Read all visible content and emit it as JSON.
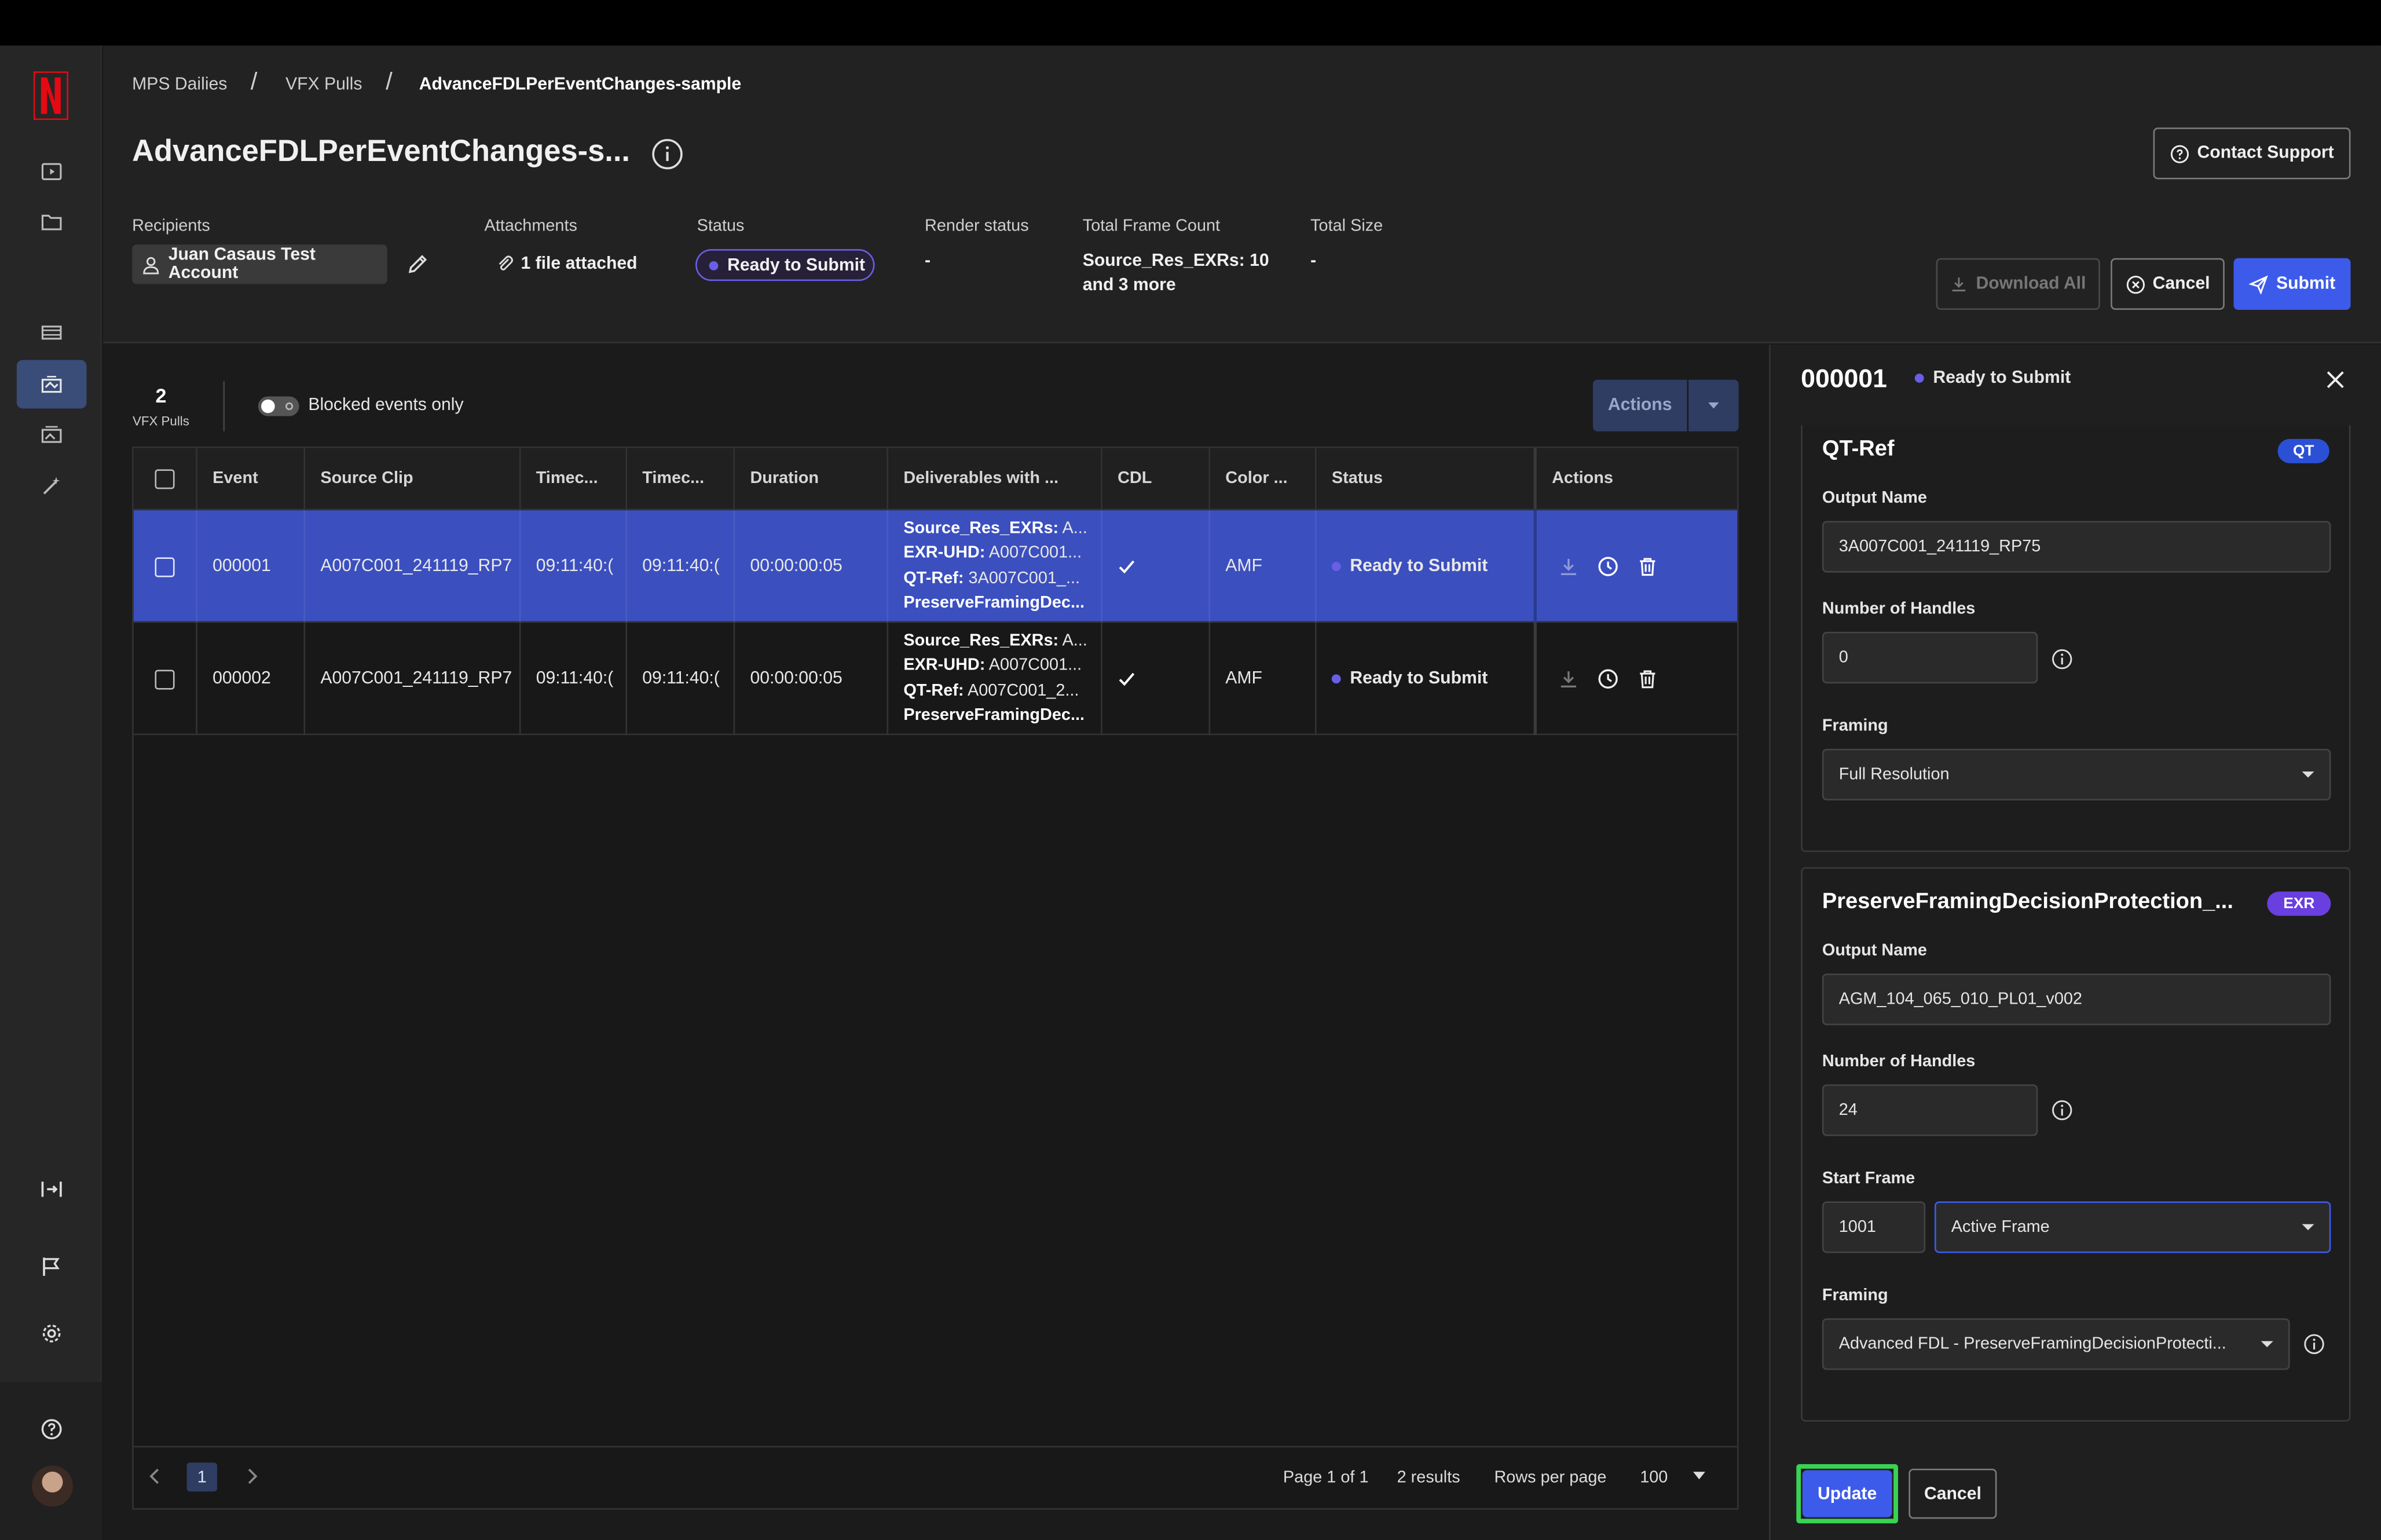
{
  "breadcrumb": [
    "MPS Dailies",
    "VFX Pulls",
    "AdvanceFDLPerEventChanges-sample"
  ],
  "title": "AdvanceFDLPerEventChanges-s...",
  "contact_support": "Contact Support",
  "meta": {
    "recipients_label": "Recipients",
    "recipient": "Juan Casaus Test Account",
    "attachments_label": "Attachments",
    "attachments_value": "1 file attached",
    "status_label": "Status",
    "status_value": "Ready to Submit",
    "render_status_label": "Render status",
    "render_status_value": "-",
    "frame_count_label": "Total Frame Count",
    "frame_count_line1": "Source_Res_EXRs: 10",
    "frame_count_line2": "and 3 more",
    "total_size_label": "Total Size",
    "total_size_value": "-"
  },
  "header_buttons": {
    "download_all": "Download All",
    "cancel": "Cancel",
    "submit": "Submit"
  },
  "toolbar": {
    "count": "2",
    "count_label": "VFX Pulls",
    "toggle_label": "Blocked events only",
    "actions": "Actions"
  },
  "table": {
    "columns": [
      "Event",
      "Source Clip",
      "Timec...",
      "Timec...",
      "Duration",
      "Deliverables with ...",
      "CDL",
      "Color ...",
      "Status",
      "Actions"
    ],
    "rows": [
      {
        "event": "000001",
        "clip": "A007C001_241119_RP7",
        "tc_in": "09:11:40:(",
        "tc_out": "09:11:40:(",
        "duration": "00:00:00:05",
        "deliv": [
          [
            "Source_Res_EXRs:",
            " A..."
          ],
          [
            "EXR-UHD:",
            " A007C001..."
          ],
          [
            "QT-Ref:",
            " 3A007C001_..."
          ],
          [
            "PreserveFramingDec...",
            ""
          ]
        ],
        "color": "AMF",
        "status": "Ready to Submit"
      },
      {
        "event": "000002",
        "clip": "A007C001_241119_RP7",
        "tc_in": "09:11:40:(",
        "tc_out": "09:11:40:(",
        "duration": "00:00:00:05",
        "deliv": [
          [
            "Source_Res_EXRs:",
            " A..."
          ],
          [
            "EXR-UHD:",
            " A007C001..."
          ],
          [
            "QT-Ref:",
            " A007C001_2..."
          ],
          [
            "PreserveFramingDec...",
            ""
          ]
        ],
        "color": "AMF",
        "status": "Ready to Submit"
      }
    ]
  },
  "pagination": {
    "page": "1",
    "page_info": "Page 1 of 1",
    "results": "2 results",
    "rows_label": "Rows per page",
    "rows_value": "100"
  },
  "panel": {
    "event_id": "000001",
    "status": "Ready to Submit",
    "card1": {
      "title": "QT-Ref",
      "badge": "QT",
      "output_label": "Output Name",
      "output_value": "3A007C001_241119_RP75",
      "handles_label": "Number of Handles",
      "handles_value": "0",
      "framing_label": "Framing",
      "framing_value": "Full Resolution"
    },
    "card2": {
      "title": "PreserveFramingDecisionProtection_...",
      "badge": "EXR",
      "output_label": "Output Name",
      "output_value": "AGM_104_065_010_PL01_v002",
      "handles_label": "Number of Handles",
      "handles_value": "24",
      "start_label": "Start Frame",
      "start_value": "1001",
      "start_mode": "Active Frame",
      "framing_label": "Framing",
      "framing_value": "Advanced FDL - PreserveFramingDecisionProtecti..."
    },
    "update": "Update",
    "cancel": "Cancel"
  },
  "colors": {
    "accent": "#3d5bea",
    "selected_row": "#3b4fbf",
    "status_dot": "#6a5ee6",
    "focus": "#39d353"
  }
}
